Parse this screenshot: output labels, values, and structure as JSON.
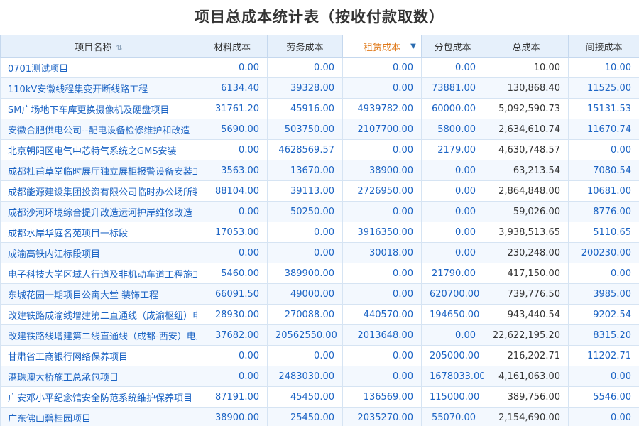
{
  "title": "项目总成本统计表（按收付款取数）",
  "columns": {
    "name": "项目名称",
    "material": "材料成本",
    "labor": "劳务成本",
    "lease": "租赁成本",
    "subcontract": "分包成本",
    "total": "总成本",
    "indirect": "间接成本"
  },
  "icons": {
    "sort": "sort-icon",
    "dropdown": "dropdown-arrow-icon"
  },
  "colors": {
    "header_bg": "#e6f0fb",
    "link_text": "#1c64c4",
    "active_header_text": "#e07b1c"
  },
  "rows": [
    {
      "name": "0701测试项目",
      "material": "0.00",
      "labor": "0.00",
      "lease": "0.00",
      "subcontract": "0.00",
      "total": "10.00",
      "indirect": "10.00"
    },
    {
      "name": "110kV安徽线程集变开断线路工程",
      "material": "6134.40",
      "labor": "39328.00",
      "lease": "0.00",
      "subcontract": "73881.00",
      "total": "130,868.40",
      "indirect": "11525.00"
    },
    {
      "name": "SM广场地下车库更换摄像机及硬盘项目",
      "material": "31761.20",
      "labor": "45916.00",
      "lease": "4939782.00",
      "subcontract": "60000.00",
      "total": "5,092,590.73",
      "indirect": "15131.53"
    },
    {
      "name": "安徽合肥供电公司--配电设备检修维护和改造",
      "material": "5690.00",
      "labor": "503750.00",
      "lease": "2107700.00",
      "subcontract": "5800.00",
      "total": "2,634,610.74",
      "indirect": "11670.74"
    },
    {
      "name": "北京朝阳区电气中芯特气系统之GMS安装",
      "material": "0.00",
      "labor": "4628569.57",
      "lease": "0.00",
      "subcontract": "2179.00",
      "total": "4,630,748.57",
      "indirect": "0.00"
    },
    {
      "name": "成都杜甫草堂临时展厅独立展柜报警设备安装工程",
      "material": "3563.00",
      "labor": "13670.00",
      "lease": "38900.00",
      "subcontract": "0.00",
      "total": "63,213.54",
      "indirect": "7080.54"
    },
    {
      "name": "成都能源建设集团投资有限公司临时办公场所装修工程",
      "material": "88104.00",
      "labor": "39113.00",
      "lease": "2726950.00",
      "subcontract": "0.00",
      "total": "2,864,848.00",
      "indirect": "10681.00"
    },
    {
      "name": "成都沙河环境综合提升改造运河护岸维修改造",
      "material": "0.00",
      "labor": "50250.00",
      "lease": "0.00",
      "subcontract": "0.00",
      "total": "59,026.00",
      "indirect": "8776.00"
    },
    {
      "name": "成都水岸华庭名苑项目一标段",
      "material": "17053.00",
      "labor": "0.00",
      "lease": "3916350.00",
      "subcontract": "0.00",
      "total": "3,938,513.65",
      "indirect": "5110.65"
    },
    {
      "name": "成渝高铁内江标段项目",
      "material": "0.00",
      "labor": "0.00",
      "lease": "30018.00",
      "subcontract": "0.00",
      "total": "230,248.00",
      "indirect": "200230.00"
    },
    {
      "name": "电子科技大学区域人行道及非机动车道工程施工",
      "material": "5460.00",
      "labor": "389900.00",
      "lease": "0.00",
      "subcontract": "21790.00",
      "total": "417,150.00",
      "indirect": "0.00"
    },
    {
      "name": "东城花园一期项目公寓大堂 装饰工程",
      "material": "66091.50",
      "labor": "49000.00",
      "lease": "0.00",
      "subcontract": "620700.00",
      "total": "739,776.50",
      "indirect": "3985.00"
    },
    {
      "name": "改建铁路成渝线增建第二直通线（成渝枢纽）电力工程",
      "material": "28930.00",
      "labor": "270088.00",
      "lease": "440570.00",
      "subcontract": "194650.00",
      "total": "943,440.54",
      "indirect": "9202.54"
    },
    {
      "name": "改建铁路线增建第二线直通线（成都-西安）电力工程",
      "material": "37682.00",
      "labor": "20562550.00",
      "lease": "2013648.00",
      "subcontract": "0.00",
      "total": "22,622,195.20",
      "indirect": "8315.20"
    },
    {
      "name": "甘肃省工商银行网络保养项目",
      "material": "0.00",
      "labor": "0.00",
      "lease": "0.00",
      "subcontract": "205000.00",
      "total": "216,202.71",
      "indirect": "11202.71"
    },
    {
      "name": "港珠澳大桥施工总承包项目",
      "material": "0.00",
      "labor": "2483030.00",
      "lease": "0.00",
      "subcontract": "1678033.00",
      "total": "4,161,063.00",
      "indirect": "0.00"
    },
    {
      "name": "广安邓小平纪念馆安全防范系统维护保养项目",
      "material": "87191.00",
      "labor": "45450.00",
      "lease": "136569.00",
      "subcontract": "115000.00",
      "total": "389,756.00",
      "indirect": "5546.00"
    },
    {
      "name": "广东佛山碧桂园项目",
      "material": "38900.00",
      "labor": "25450.00",
      "lease": "2035270.00",
      "subcontract": "55070.00",
      "total": "2,154,690.00",
      "indirect": "0.00"
    }
  ]
}
